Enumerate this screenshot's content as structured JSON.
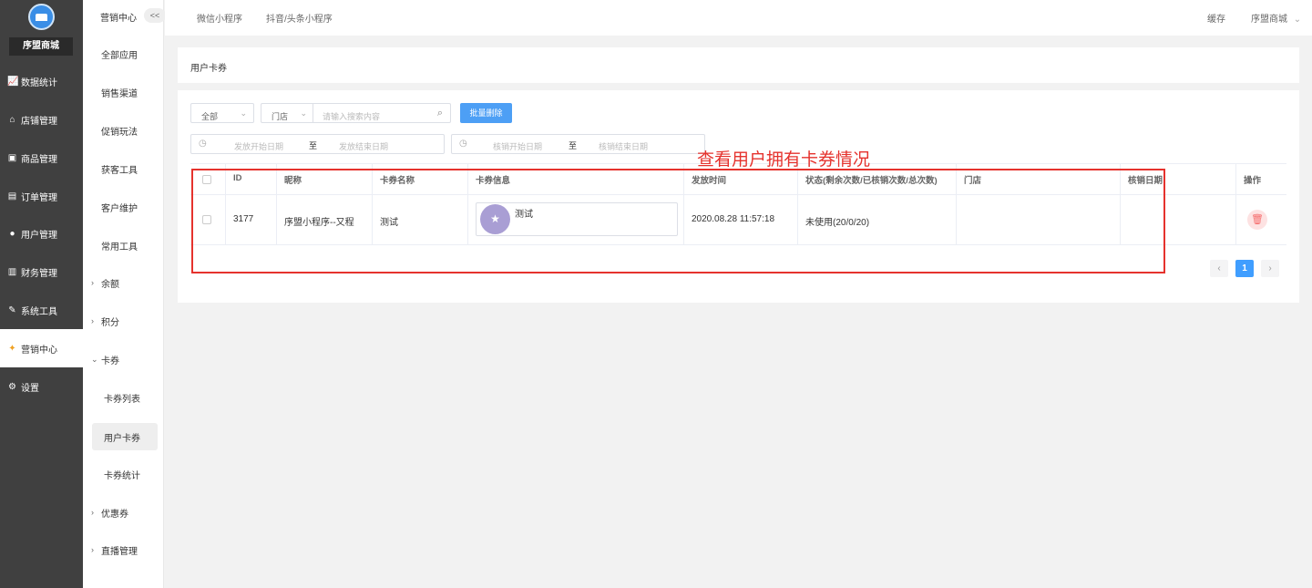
{
  "sidebar": {
    "shop_name": "序盟商城",
    "items": [
      {
        "icon": "chart-icon",
        "glyph": "📈",
        "label": "数据统计"
      },
      {
        "icon": "store-icon",
        "glyph": "⌂",
        "label": "店铺管理"
      },
      {
        "icon": "product-icon",
        "glyph": "▣",
        "label": "商品管理"
      },
      {
        "icon": "order-icon",
        "glyph": "▤",
        "label": "订单管理"
      },
      {
        "icon": "user-icon",
        "glyph": "●",
        "label": "用户管理"
      },
      {
        "icon": "finance-icon",
        "glyph": "▥",
        "label": "财务管理"
      },
      {
        "icon": "wrench-icon",
        "glyph": "✎",
        "label": "系统工具"
      },
      {
        "icon": "marketing-icon",
        "glyph": "✦",
        "label": "营销中心"
      },
      {
        "icon": "settings-icon",
        "glyph": "⚙",
        "label": "设置"
      }
    ]
  },
  "subbar": {
    "title": "营销中心",
    "collapse": "<<",
    "items": [
      {
        "label": "全部应用"
      },
      {
        "label": "销售渠道"
      },
      {
        "label": "促销玩法"
      },
      {
        "label": "获客工具"
      },
      {
        "label": "客户维护"
      },
      {
        "label": "常用工具"
      },
      {
        "label": "余额"
      },
      {
        "label": "积分"
      },
      {
        "label": "卡券"
      },
      {
        "label": "卡券列表"
      },
      {
        "label": "用户卡券"
      },
      {
        "label": "卡券统计"
      },
      {
        "label": "优惠券"
      },
      {
        "label": "直播管理"
      }
    ]
  },
  "topbar": {
    "tabs": [
      "微信小程序",
      "抖音/头条小程序"
    ],
    "cache": "缓存",
    "shop": "序盟商城"
  },
  "page": {
    "title": "用户卡券"
  },
  "filters": {
    "type_select": "全部",
    "store_select": "门店",
    "search_placeholder": "请输入搜索内容",
    "batch_delete": "批量删除",
    "issue_start": "发放开始日期",
    "issue_end": "发放结束日期",
    "verify_start": "核销开始日期",
    "verify_end": "核销结束日期",
    "range_sep": "至"
  },
  "table": {
    "headers": [
      "ID",
      "昵称",
      "卡券名称",
      "卡券信息",
      "发放时间",
      "状态(剩余次数/已核销次数/总次数)",
      "门店",
      "核销日期",
      "操作"
    ],
    "rows": [
      {
        "id": "3177",
        "nickname": "序盟小程序--又程",
        "card_name": "测试",
        "card_info_name": "测试",
        "issue_time": "2020.08.28 11:57:18",
        "status": "未使用(20/0/20)",
        "store": "",
        "verify_date": ""
      }
    ]
  },
  "pagination": {
    "prev": "‹",
    "current": "1",
    "next": "›"
  },
  "annotation": {
    "text": "查看用户拥有卡券情况",
    "color": "#e5322d"
  }
}
